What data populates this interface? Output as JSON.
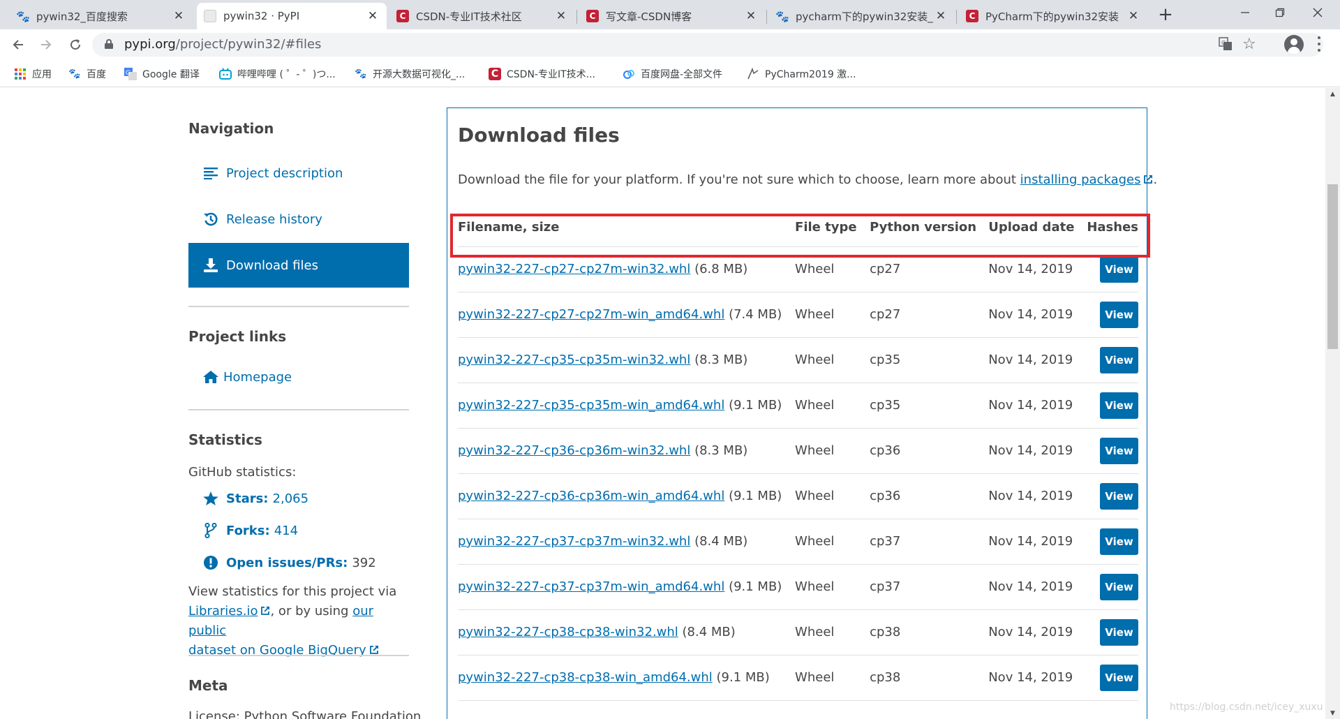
{
  "browser": {
    "tabs": [
      {
        "title": "pywin32_百度搜索",
        "favicon": "baidu-paw-icon",
        "active": false
      },
      {
        "title": "pywin32 · PyPI",
        "favicon": "pypi-icon",
        "active": true
      },
      {
        "title": "CSDN-专业IT技术社区",
        "favicon": "csdn-icon",
        "active": false
      },
      {
        "title": "写文章-CSDN博客",
        "favicon": "csdn-icon",
        "active": false
      },
      {
        "title": "pycharm下的pywin32安装_",
        "favicon": "baidu-paw-icon",
        "active": false
      },
      {
        "title": "PyCharm下的pywin32安装",
        "favicon": "csdn-icon",
        "active": false
      }
    ],
    "tab_close_glyph": "✕",
    "url_host": "pypi.org",
    "url_rest": "/project/pywin32/#files",
    "bookmarks": [
      {
        "label": "应用",
        "icon": "apps-grid-icon"
      },
      {
        "label": "百度",
        "icon": "baidu-paw-icon"
      },
      {
        "label": "Google 翻译",
        "icon": "google-translate-icon"
      },
      {
        "label": "哔哩哔哩 ( ゜- ゜)つ...",
        "icon": "bilibili-icon"
      },
      {
        "label": "开源大数据可视化_...",
        "icon": "baidu-paw-icon"
      },
      {
        "label": "CSDN-专业IT技术...",
        "icon": "csdn-icon"
      },
      {
        "label": "百度网盘-全部文件",
        "icon": "baidu-netdisk-icon"
      },
      {
        "label": "PyCharm2019 激...",
        "icon": "pycharm-icon"
      }
    ]
  },
  "sidebar": {
    "navigation_heading": "Navigation",
    "nav_items": [
      {
        "label": "Project description",
        "icon": "align-left-icon",
        "active": false
      },
      {
        "label": "Release history",
        "icon": "history-icon",
        "active": false
      },
      {
        "label": "Download files",
        "icon": "download-icon",
        "active": true
      }
    ],
    "project_links_heading": "Project links",
    "homepage_label": "Homepage",
    "statistics_heading": "Statistics",
    "github_stats_label": "GitHub statistics:",
    "stats": [
      {
        "label": "Stars:",
        "value": "2,065",
        "icon": "star-icon"
      },
      {
        "label": "Forks:",
        "value": "414",
        "icon": "code-branch-icon"
      },
      {
        "label": "Open issues/PRs:",
        "value": "392",
        "icon": "info-circle-icon"
      }
    ],
    "stats_text_1": "View statistics for this project via",
    "libraries_link": "Libraries.io",
    "stats_text_2": ", or by using",
    "bigquery_link_1": "our public",
    "bigquery_link_2": "dataset on Google BigQuery",
    "meta_heading": "Meta",
    "license_partial": "License: Python Software Foundation"
  },
  "main": {
    "title": "Download files",
    "intro_text": "Download the file for your platform. If you're not sure which to choose, learn more about",
    "intro_link": "installing packages",
    "intro_end": ".",
    "table": {
      "headers": [
        "Filename, size",
        "File type",
        "Python version",
        "Upload date",
        "Hashes"
      ],
      "view_label": "View",
      "rows": [
        {
          "filename": "pywin32-227-cp27-cp27m-win32.whl",
          "size": "(6.8 MB)",
          "type": "Wheel",
          "python": "cp27",
          "date": "Nov 14, 2019"
        },
        {
          "filename": "pywin32-227-cp27-cp27m-win_amd64.whl",
          "size": "(7.4 MB)",
          "type": "Wheel",
          "python": "cp27",
          "date": "Nov 14, 2019"
        },
        {
          "filename": "pywin32-227-cp35-cp35m-win32.whl",
          "size": "(8.3 MB)",
          "type": "Wheel",
          "python": "cp35",
          "date": "Nov 14, 2019"
        },
        {
          "filename": "pywin32-227-cp35-cp35m-win_amd64.whl",
          "size": "(9.1 MB)",
          "type": "Wheel",
          "python": "cp35",
          "date": "Nov 14, 2019"
        },
        {
          "filename": "pywin32-227-cp36-cp36m-win32.whl",
          "size": "(8.3 MB)",
          "type": "Wheel",
          "python": "cp36",
          "date": "Nov 14, 2019"
        },
        {
          "filename": "pywin32-227-cp36-cp36m-win_amd64.whl",
          "size": "(9.1 MB)",
          "type": "Wheel",
          "python": "cp36",
          "date": "Nov 14, 2019"
        },
        {
          "filename": "pywin32-227-cp37-cp37m-win32.whl",
          "size": "(8.4 MB)",
          "type": "Wheel",
          "python": "cp37",
          "date": "Nov 14, 2019"
        },
        {
          "filename": "pywin32-227-cp37-cp37m-win_amd64.whl",
          "size": "(9.1 MB)",
          "type": "Wheel",
          "python": "cp37",
          "date": "Nov 14, 2019"
        },
        {
          "filename": "pywin32-227-cp38-cp38-win32.whl",
          "size": "(8.4 MB)",
          "type": "Wheel",
          "python": "cp38",
          "date": "Nov 14, 2019"
        },
        {
          "filename": "pywin32-227-cp38-cp38-win_amd64.whl",
          "size": "(9.1 MB)",
          "type": "Wheel",
          "python": "cp38",
          "date": "Nov 14, 2019"
        }
      ]
    }
  },
  "watermark": "https://blog.csdn.net/icey_xuxu",
  "colors": {
    "pypi_blue": "#006dad",
    "highlight_red": "#e0282e",
    "csdn_red": "#c32136"
  }
}
